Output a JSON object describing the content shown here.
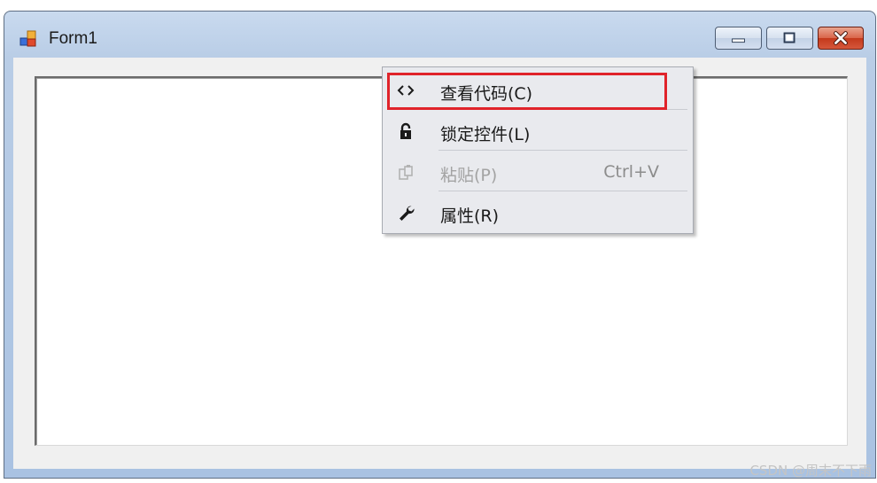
{
  "window": {
    "title": "Form1",
    "icon": "winform-app-icon",
    "controls": [
      "minimize-icon",
      "maximize-icon",
      "close-icon"
    ]
  },
  "context_menu": {
    "items": [
      {
        "label": "查看代码(C)",
        "icon": "code-brackets-icon",
        "enabled": true,
        "highlighted": true
      },
      {
        "label": "锁定控件(L)",
        "icon": "lock-icon",
        "enabled": true
      },
      {
        "label": "粘贴(P)",
        "icon": "paste-icon",
        "enabled": false,
        "shortcut": "Ctrl+V"
      },
      {
        "label": "属性(R)",
        "icon": "wrench-icon",
        "enabled": true
      }
    ]
  },
  "colors": {
    "highlight_border": "#e0232a",
    "menu_bg": "#e9eaee",
    "disabled_text": "#a3a3a3"
  },
  "watermark": "CSDN @周末不下雨"
}
